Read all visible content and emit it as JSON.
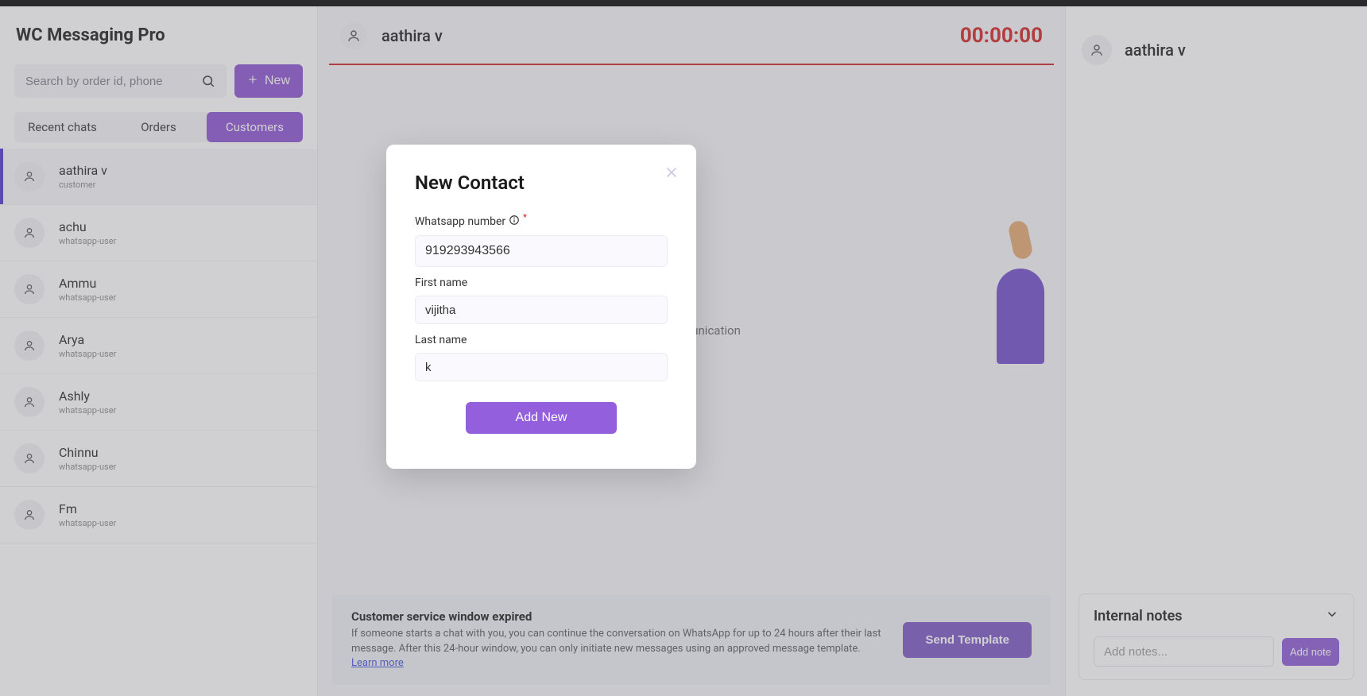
{
  "app_title": "WC Messaging Pro",
  "search": {
    "placeholder": "Search by order id, phone"
  },
  "new_button": "New",
  "tabs": {
    "recent": "Recent chats",
    "orders": "Orders",
    "customers": "Customers"
  },
  "contacts": [
    {
      "name": "aathira v",
      "sub": "customer",
      "selected": true
    },
    {
      "name": "achu",
      "sub": "whatsapp-user",
      "selected": false
    },
    {
      "name": "Ammu",
      "sub": "whatsapp-user",
      "selected": false
    },
    {
      "name": "Arya",
      "sub": "whatsapp-user",
      "selected": false
    },
    {
      "name": "Ashly",
      "sub": "whatsapp-user",
      "selected": false
    },
    {
      "name": "Chinnu",
      "sub": "whatsapp-user",
      "selected": false
    },
    {
      "name": "Fm",
      "sub": "whatsapp-user",
      "selected": false
    }
  ],
  "main": {
    "header_name": "aathira v",
    "timer": "00:00:00",
    "center_sub": "es communication"
  },
  "expired": {
    "heading": "Customer service window expired",
    "body": "If someone starts a chat with you, you can continue the conversation on WhatsApp for up to 24 hours after their last message. After this 24-hour window, you can only initiate new messages using an approved message template. ",
    "learn_more": "Learn more",
    "button": "Send Template"
  },
  "right": {
    "name": "aathira v",
    "notes_title": "Internal notes",
    "notes_placeholder": "Add notes...",
    "add_note_btn": "Add note"
  },
  "modal": {
    "title": "New Contact",
    "whatsapp_label": "Whatsapp number",
    "whatsapp_value": "919293943566",
    "first_name_label": "First name",
    "first_name_value": "vijitha",
    "last_name_label": "Last name",
    "last_name_value": "k",
    "submit": "Add New"
  }
}
